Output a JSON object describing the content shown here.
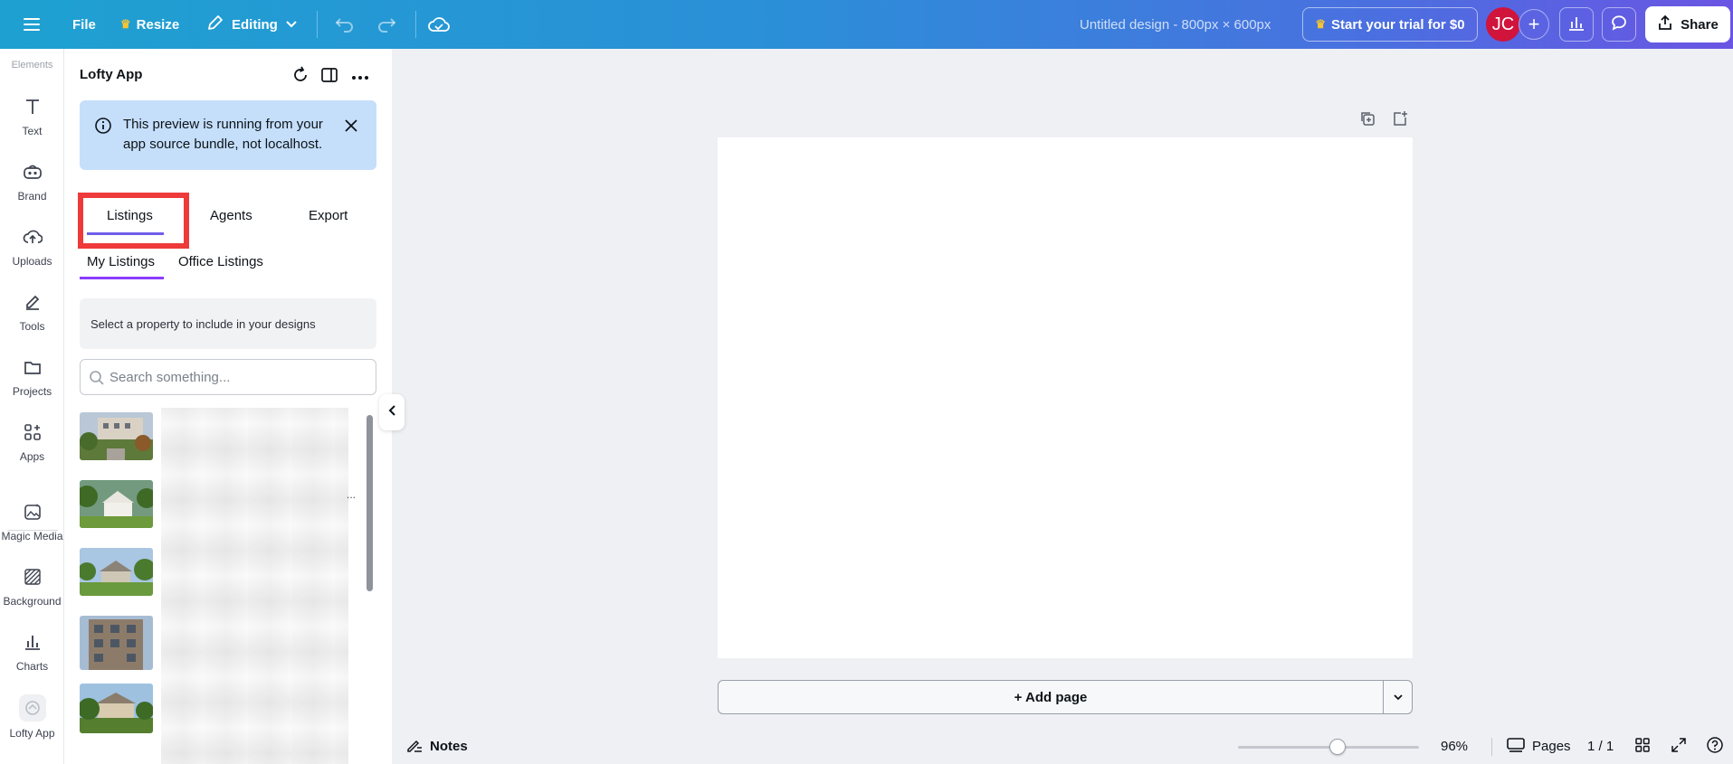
{
  "topbar": {
    "file_label": "File",
    "resize_label": "Resize",
    "editing_label": "Editing",
    "design_title": "Untitled design - 800px × 600px",
    "trial_label": "Start your trial for $0",
    "avatar_initials": "JC",
    "share_label": "Share"
  },
  "rail": {
    "top_label": "Elements",
    "items": [
      {
        "label": "Text",
        "icon": "text-icon"
      },
      {
        "label": "Brand",
        "icon": "brand-icon"
      },
      {
        "label": "Uploads",
        "icon": "cloud-upload-icon"
      },
      {
        "label": "Tools",
        "icon": "pen-icon"
      },
      {
        "label": "Projects",
        "icon": "folder-icon"
      },
      {
        "label": "Apps",
        "icon": "apps-icon"
      },
      {
        "label": "Magic Media",
        "icon": "magic-media-icon"
      },
      {
        "label": "Background",
        "icon": "background-icon"
      },
      {
        "label": "Charts",
        "icon": "charts-icon"
      },
      {
        "label": "Lofty App",
        "icon": "lofty-app-icon"
      }
    ]
  },
  "panel": {
    "title": "Lofty App",
    "banner_text": "This preview is running from your app source bundle, not localhost.",
    "tabs": [
      {
        "label": "Listings",
        "active": true
      },
      {
        "label": "Agents",
        "active": false
      },
      {
        "label": "Export",
        "active": false
      }
    ],
    "subtabs": [
      {
        "label": "My Listings",
        "active": true
      },
      {
        "label": "Office Listings",
        "active": false
      }
    ],
    "hint": "Select a property to include in your designs",
    "search_placeholder": "Search something..."
  },
  "canvas": {
    "add_page_label": "+ Add page"
  },
  "bottombar": {
    "notes_label": "Notes",
    "zoom": "96%",
    "zoom_fraction": 0.55,
    "pages_label": "Pages",
    "page_count": "1 / 1"
  },
  "colors": {
    "accent_purple": "#8b3dff",
    "highlight_red": "#ee3a3a",
    "avatar_red": "#d0143c",
    "banner_blue": "#c5dffb"
  }
}
